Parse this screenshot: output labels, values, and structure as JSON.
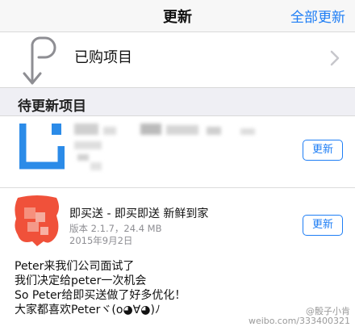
{
  "navbar": {
    "title": "更新",
    "update_all_label": "全部更新"
  },
  "purchased": {
    "label": "已购项目",
    "icon": "purchased-icon"
  },
  "section": {
    "header": "待更新项目"
  },
  "apps": [
    {
      "update_label": "更新",
      "accent": "#2b8be8"
    },
    {
      "name": "即买送 - 即买即送 新鲜到家",
      "version": "版本 2.1.7，24.4 MB",
      "date": "2015年9月2日",
      "update_label": "更新",
      "accent": "#f0513a"
    }
  ],
  "caption_lines": [
    "Peter来我们公司面试了",
    "我们决定给peter一次机会",
    "So Peter给即买送做了好多优化！",
    "大家都喜欢Peterヾ(o◕∀◕)ﾉ"
  ],
  "watermark": {
    "line1": "@骰子小肯",
    "line2": "weibo.com/333400321"
  },
  "colors": {
    "accent": "#1e7ef5",
    "separator": "#d9d9d9",
    "section_bg": "#efeff4"
  }
}
